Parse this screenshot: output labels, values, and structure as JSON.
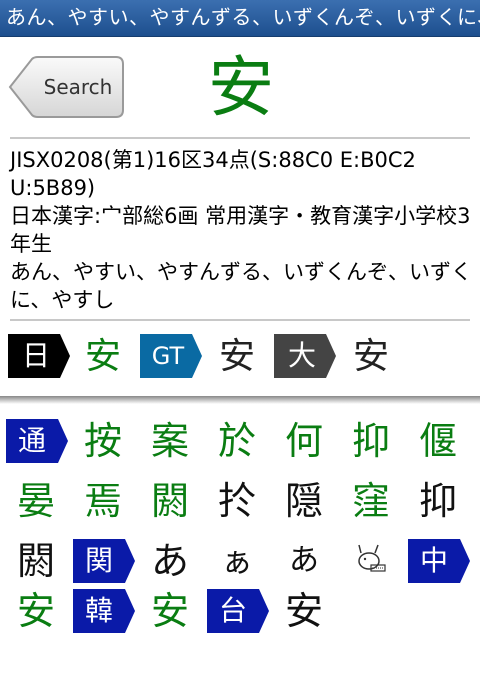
{
  "title": "あん、やすい、やすんずる、いずくんぞ、いずくに、やすし",
  "search_button": "Search",
  "kanji": "安",
  "info": {
    "line1": "JISX0208(第1)16区34点(S:88C0 E:B0C2 U:5B89)",
    "line2": "日本漢字:宀部総6画 常用漢字・教育漢字小学校3年生",
    "line3": "あん、やすい、やすんずる、いずくんぞ、いずくに、やすし"
  },
  "variants": [
    {
      "tag": "日",
      "char": "安",
      "tag_color": "#000000",
      "char_color": "#0a7d12"
    },
    {
      "tag": "GT",
      "char": "安",
      "tag_color": "#0a6aa3",
      "char_color": "#222222"
    },
    {
      "tag": "大",
      "char": "安",
      "tag_color": "#444444",
      "char_color": "#222222"
    }
  ],
  "related": [
    {
      "text": "通",
      "kind": "tag"
    },
    {
      "text": "按",
      "kind": "green"
    },
    {
      "text": "案",
      "kind": "green"
    },
    {
      "text": "於",
      "kind": "green"
    },
    {
      "text": "何",
      "kind": "green"
    },
    {
      "text": "抑",
      "kind": "green"
    },
    {
      "text": "偃",
      "kind": "green"
    },
    {
      "text": "晏",
      "kind": "green"
    },
    {
      "text": "焉",
      "kind": "green"
    },
    {
      "text": "閼",
      "kind": "green"
    },
    {
      "text": "扵",
      "kind": "black"
    },
    {
      "text": "隠",
      "kind": "black"
    },
    {
      "text": "窪",
      "kind": "green"
    },
    {
      "text": "抑",
      "kind": "black"
    },
    {
      "text": "閼",
      "kind": "black"
    },
    {
      "text": "関",
      "kind": "tag"
    },
    {
      "text": "あ",
      "kind": "black"
    },
    {
      "text": "ぁ",
      "kind": "black"
    },
    {
      "text": "あ",
      "kind": "black"
    },
    {
      "text": "☋",
      "kind": "black"
    },
    {
      "text": "中",
      "kind": "tag"
    },
    {
      "text": "安",
      "kind": "green"
    },
    {
      "text": "韓",
      "kind": "tag"
    },
    {
      "text": "安",
      "kind": "green"
    },
    {
      "text": "台",
      "kind": "tag"
    },
    {
      "text": "安",
      "kind": "black"
    }
  ],
  "colors": {
    "accent_green": "#0a7d12",
    "tag_blue": "#0a1aa8",
    "titlebar": "#2a5ea0"
  }
}
